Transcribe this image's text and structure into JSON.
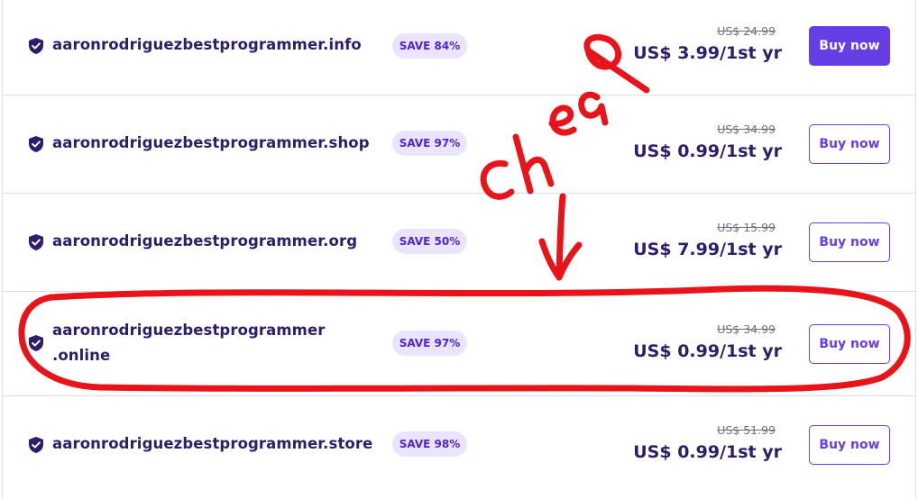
{
  "rows": [
    {
      "domain": "aaronrodriguezbestprogrammer.info",
      "badge": "SAVE 84%",
      "old_price": "US$ 24.99",
      "price": "US$ 3.99/1st yr",
      "button": "Buy now"
    },
    {
      "domain": "aaronrodriguezbestprogrammer.shop",
      "badge": "SAVE 97%",
      "old_price": "US$ 34.99",
      "price": "US$ 0.99/1st yr",
      "button": "Buy now"
    },
    {
      "domain": "aaronrodriguezbestprogrammer.org",
      "badge": "SAVE 50%",
      "old_price": "US$ 15.99",
      "price": "US$ 7.99/1st yr",
      "button": "Buy now"
    },
    {
      "domain_line1": "aaronrodriguezbestprogrammer",
      "domain_line2": ".online",
      "badge": "SAVE 97%",
      "old_price": "US$ 34.99",
      "price": "US$ 0.99/1st yr",
      "button": "Buy now"
    },
    {
      "domain": "aaronrodriguezbestprogrammer.store",
      "badge": "SAVE 98%",
      "old_price": "US$ 51.99",
      "price": "US$ 0.99/1st yr",
      "button": "Buy now"
    }
  ],
  "annotation": {
    "text": "cheap",
    "color": "#e8141a"
  },
  "colors": {
    "brand": "#673de6",
    "text_dark": "#2f1c6a",
    "badge_bg": "#ebe4ff",
    "badge_text": "#5025d1",
    "divider": "#dadce6"
  },
  "icons": {
    "verified": "shield-check-icon"
  }
}
